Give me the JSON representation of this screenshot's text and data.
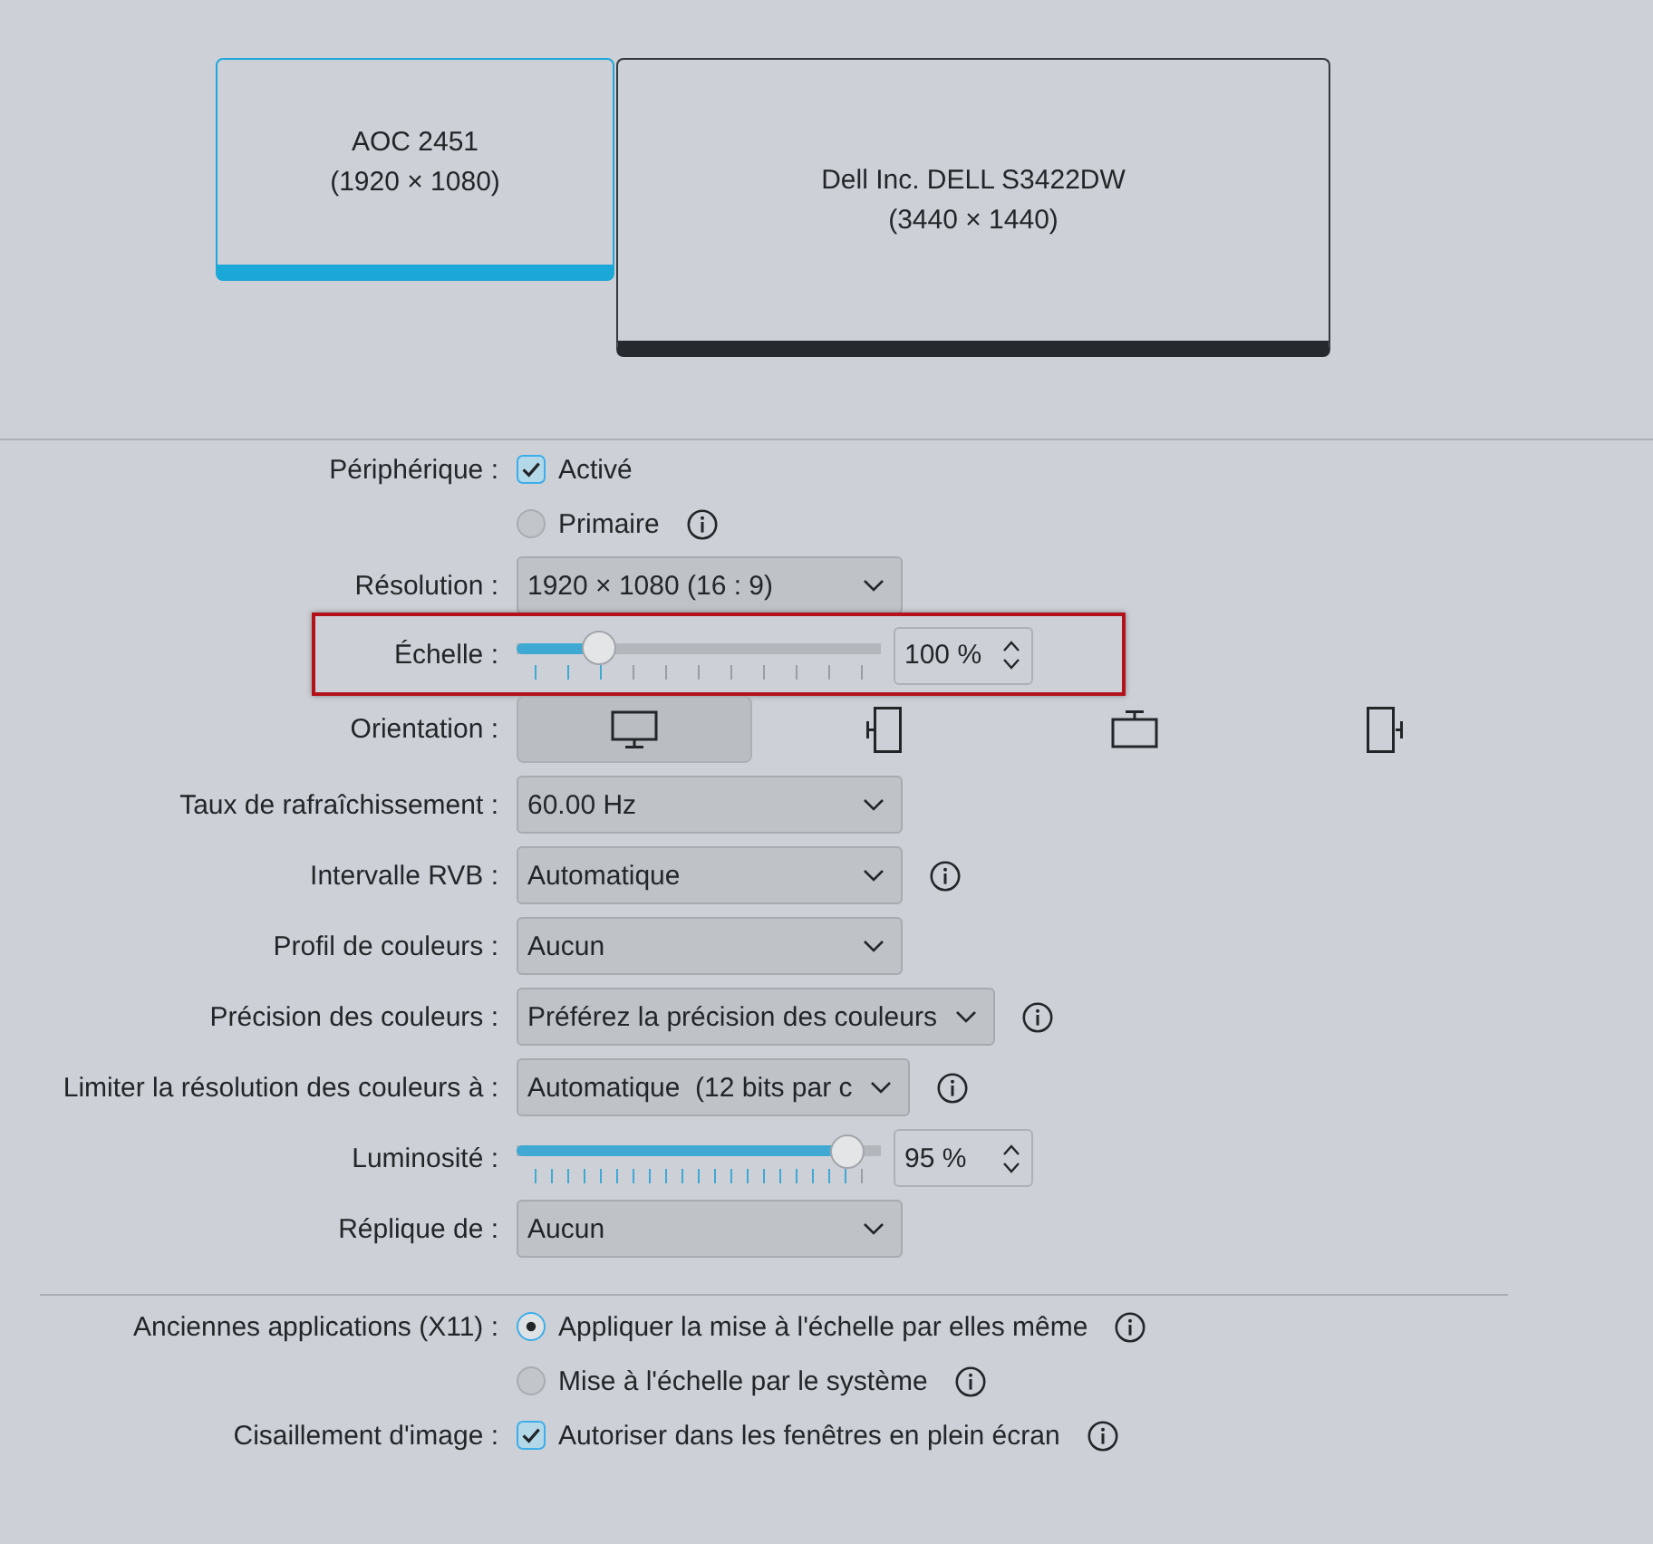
{
  "monitors": [
    {
      "name": "AOC 2451",
      "resolution": "(1920 × 1080)",
      "selected": true
    },
    {
      "name": "Dell Inc. DELL S3422DW",
      "resolution": "(3440 × 1440)",
      "selected": false
    }
  ],
  "sections": [
    {
      "rows": [
        {
          "kind": "checkbox",
          "label": "Périphérique :",
          "text": "Activé",
          "checked": true
        },
        {
          "kind": "radio",
          "text": "Primaire",
          "checked": false,
          "info": true
        },
        {
          "kind": "combo",
          "label": "Résolution :",
          "value": "1920 × 1080 (16 : 9)"
        },
        {
          "kind": "slider",
          "label": "Échelle :",
          "level": 0.2,
          "reading": "100 %",
          "highlighted": true
        },
        {
          "kind": "orientation",
          "label": "Orientation :",
          "options": [
            {
              "kind": "landscape",
              "selected": true
            },
            {
              "kind": "left",
              "selected": false
            },
            {
              "kind": "inverted",
              "selected": false
            },
            {
              "kind": "right",
              "selected": false
            }
          ]
        },
        {
          "kind": "combo",
          "label": "Taux de rafraîchissement :",
          "value": "60.00 Hz"
        },
        {
          "kind": "combo",
          "label": "Intervalle RVB :",
          "value": "Automatique",
          "info": true
        },
        {
          "kind": "combo",
          "label": "Profil de couleurs :",
          "value": "Aucun"
        },
        {
          "kind": "combo",
          "label": "Précision des couleurs :",
          "value": "Préférez la précision des couleurs",
          "info": true
        },
        {
          "kind": "combo",
          "label": "Limiter la résolution des couleurs à :",
          "value": "Automatique  (12 bits par c",
          "info": true
        },
        {
          "kind": "slider",
          "label": "Luminosité :",
          "level": 0.95,
          "reading": "95 %"
        },
        {
          "kind": "combo",
          "label": "Réplique de :",
          "value": "Aucun"
        }
      ]
    },
    {
      "rows": [
        {
          "kind": "radio",
          "label": "Anciennes applications (X11) :",
          "text": "Appliquer la mise à l'échelle par elles même",
          "checked": true,
          "info": true
        },
        {
          "kind": "radio",
          "text": "Mise à l'échelle par le système",
          "checked": false,
          "info": true
        },
        {
          "kind": "checkbox",
          "label": "Cisaillement d'image :",
          "text": "Autoriser dans les fenêtres en plein écran",
          "checked": true,
          "info": true
        }
      ]
    }
  ]
}
